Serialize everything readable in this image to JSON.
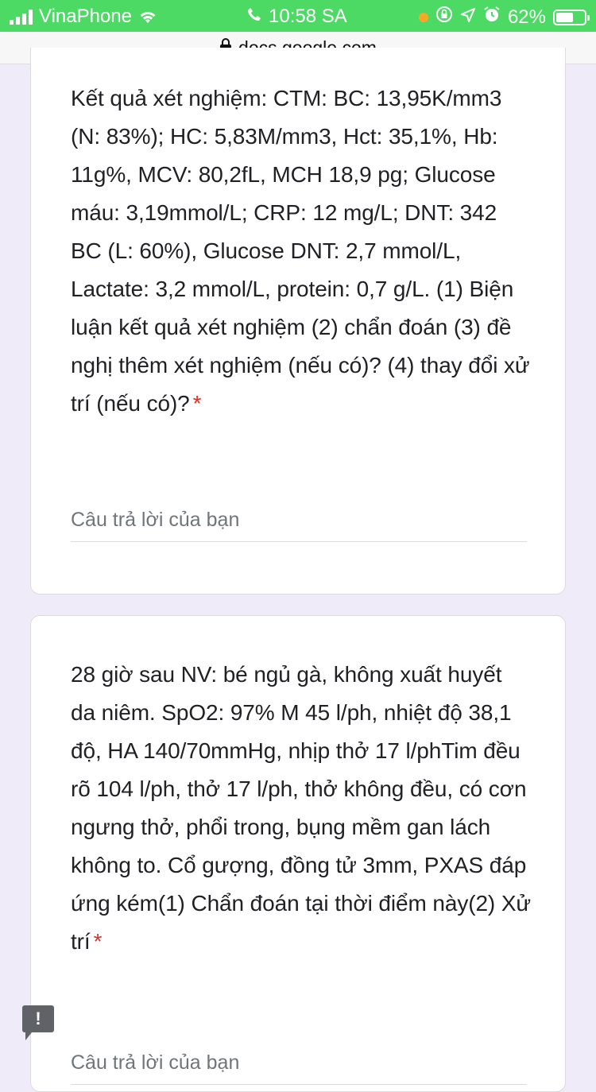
{
  "status_bar": {
    "carrier": "VinaPhone",
    "time": "10:58 SA",
    "battery": "62%",
    "battery_level": 0.62
  },
  "url_bar": {
    "domain": "docs.google.com"
  },
  "questions": [
    {
      "text": "Kết quả xét nghiệm: CTM: BC: 13,95K/mm3 (N: 83%); HC: 5,83M/mm3, Hct: 35,1%, Hb: 11g%, MCV: 80,2fL, MCH 18,9 pg; Glucose máu: 3,19mmol/L; CRP: 12 mg/L; DNT: 342 BC (L: 60%), Glucose DNT: 2,7 mmol/L, Lactate: 3,2 mmol/L, protein: 0,7 g/L. (1) Biện luận kết quả xét nghiệm (2) chẩn đoán (3) đề nghị thêm xét nghiệm (nếu có)? (4) thay đổi xử trí (nếu có)?",
      "required_mark": "*",
      "answer_placeholder": "Câu trả lời của bạn"
    },
    {
      "text": "28 giờ sau NV: bé ngủ gà, không xuất huyết da niêm. SpO2: 97% M 45 l/ph, nhiệt độ 38,1 độ, HA 140/70mmHg, nhịp thở 17 l/phTim đều rõ 104 l/ph, thở 17 l/ph, thở không đều, có cơn ngưng thở, phổi trong, bụng mềm gan lách không to. Cổ gượng, đồng tử 3mm, PXAS đáp ứng kém(1) Chẩn đoán tại thời điểm này(2) Xử trí",
      "required_mark": "*",
      "answer_placeholder": "Câu trả lời của bạn"
    }
  ],
  "feedback_button": {
    "label": "!"
  },
  "colors": {
    "status_bar": "#4cd964",
    "required": "#d93025",
    "background": "#f0ebf8"
  }
}
